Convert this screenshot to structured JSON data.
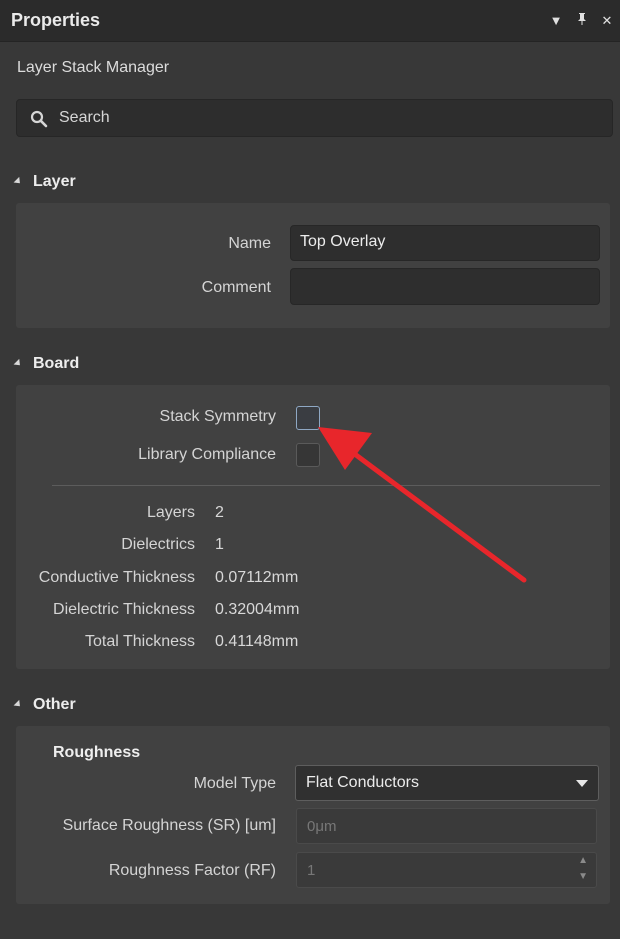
{
  "panel": {
    "title": "Properties",
    "controls": {
      "menu_icon": "dropdown-icon",
      "pin_icon": "pin-icon",
      "close_icon": "close-icon"
    }
  },
  "subtitle": "Layer Stack Manager",
  "search": {
    "placeholder": "Search",
    "icon": "search-icon"
  },
  "layer": {
    "header": "Layer",
    "name_label": "Name",
    "name_value": "Top Overlay",
    "comment_label": "Comment",
    "comment_value": ""
  },
  "board": {
    "header": "Board",
    "stack_symmetry_label": "Stack Symmetry",
    "stack_symmetry_checked": false,
    "library_compliance_label": "Library Compliance",
    "library_compliance_checked": false,
    "stats": [
      {
        "label": "Layers",
        "value": "2"
      },
      {
        "label": "Dielectrics",
        "value": "1"
      },
      {
        "label": "Conductive Thickness",
        "value": "0.07112mm"
      },
      {
        "label": "Dielectric Thickness",
        "value": "0.32004mm"
      },
      {
        "label": "Total Thickness",
        "value": "0.41148mm"
      }
    ]
  },
  "other": {
    "header": "Other",
    "roughness_title": "Roughness",
    "model_type_label": "Model Type",
    "model_type_value": "Flat Conductors",
    "surface_roughness_label": "Surface Roughness (SR) [um]",
    "surface_roughness_value": "0μm",
    "roughness_factor_label": "Roughness Factor (RF)",
    "roughness_factor_value": "1"
  },
  "colors": {
    "background": "#383838",
    "titlebar": "#2b2b2b",
    "panel": "#414141",
    "annotation_arrow": "#e8262b"
  }
}
